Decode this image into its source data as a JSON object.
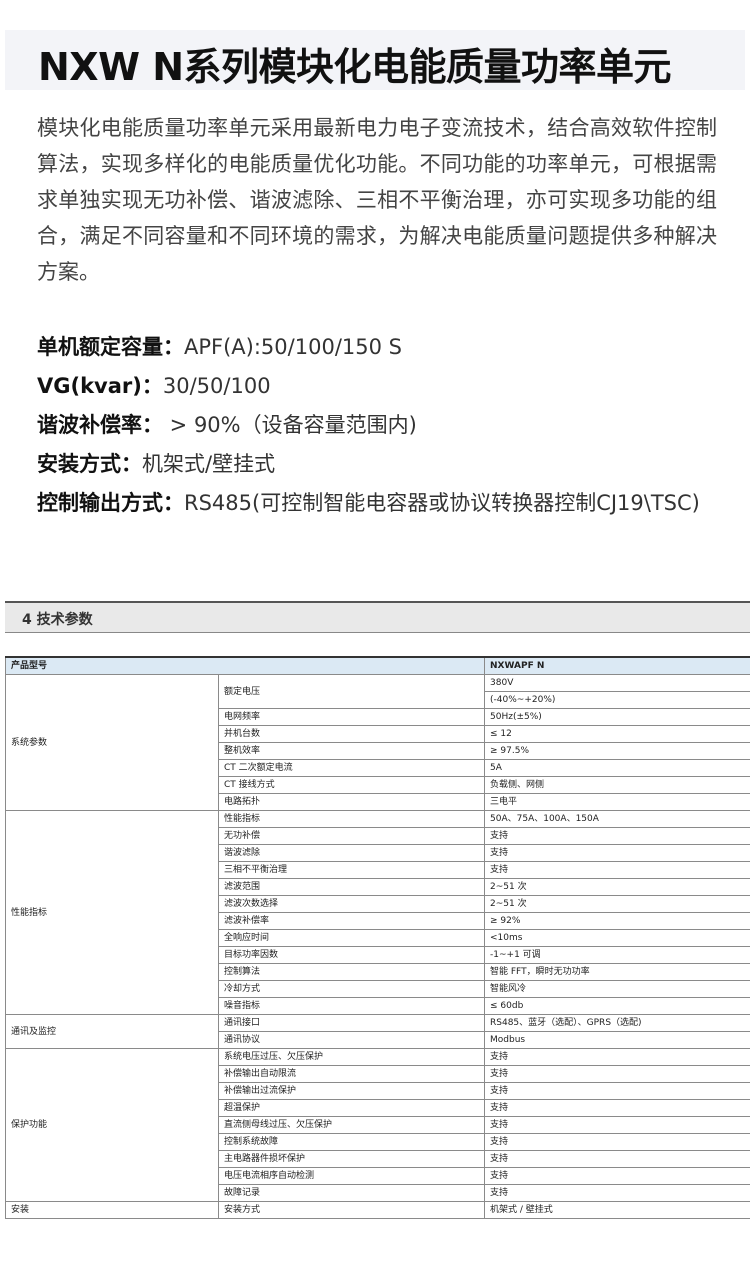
{
  "title": "NXW N系列模块化电能质量功率单元",
  "intro": "模块化电能质量功率单元采用最新电力电子变流技术，结合高效软件控制算法，实现多样化的电能质量优化功能。不同功能的功率单元，可根据需求单独实现无功补偿、谐波滤除、三相不平衡治理，亦可实现多功能的组合，满足不同容量和不同环境的需求，为解决电能质量问题提供多种解决方案。",
  "specs": [
    {
      "label": "单机额定容量：",
      "value": "APF(A):50/100/150 S"
    },
    {
      "label": "VG(kvar)：",
      "value": "30/50/100"
    },
    {
      "label": "谐波补偿率：",
      "value": " > 90%（设备容量范围内)"
    },
    {
      "label": "安装方式：",
      "value": "机架式/壁挂式"
    },
    {
      "label": "控制输出方式：",
      "value": "RS485(可控制智能电容器或协议转换器控制CJ19\\TSC)"
    }
  ],
  "section_title": "4 技术参数",
  "table": {
    "header": {
      "label": "产品型号",
      "model": "NXWAPF N"
    },
    "groups": [
      {
        "category": "系统参数",
        "rows": [
          {
            "item": "额定电压",
            "values": [
              "380V",
              "(-40%~+20%)"
            ]
          },
          {
            "item": "电网频率",
            "values": [
              "50Hz(±5%)"
            ]
          },
          {
            "item": "并机台数",
            "values": [
              "≤ 12"
            ]
          },
          {
            "item": "整机效率",
            "values": [
              "≥ 97.5%"
            ]
          },
          {
            "item": "CT 二次额定电流",
            "values": [
              "5A"
            ]
          },
          {
            "item": "CT 接线方式",
            "values": [
              "负载侧、网侧"
            ]
          },
          {
            "item": "电路拓扑",
            "values": [
              "三电平"
            ]
          }
        ]
      },
      {
        "category": "性能指标",
        "rows": [
          {
            "item": "性能指标",
            "values": [
              "50A、75A、100A、150A"
            ]
          },
          {
            "item": "无功补偿",
            "values": [
              "支持"
            ]
          },
          {
            "item": "谐波滤除",
            "values": [
              "支持"
            ]
          },
          {
            "item": "三相不平衡治理",
            "values": [
              "支持"
            ]
          },
          {
            "item": "滤波范围",
            "values": [
              "2~51 次"
            ]
          },
          {
            "item": "滤波次数选择",
            "values": [
              "2~51 次"
            ]
          },
          {
            "item": "滤波补偿率",
            "values": [
              "≥ 92%"
            ]
          },
          {
            "item": "全响应时间",
            "values": [
              "<10ms"
            ]
          },
          {
            "item": "目标功率因数",
            "values": [
              "-1~+1 可调"
            ]
          },
          {
            "item": "控制算法",
            "values": [
              "智能 FFT，瞬时无功功率"
            ]
          },
          {
            "item": "冷却方式",
            "values": [
              "智能风冷"
            ]
          },
          {
            "item": "噪音指标",
            "values": [
              "≤ 60db"
            ]
          }
        ]
      },
      {
        "category": "通讯及监控",
        "rows": [
          {
            "item": "通讯接口",
            "values": [
              "RS485、蓝牙（选配）、GPRS（选配)"
            ]
          },
          {
            "item": "通讯协议",
            "values": [
              "Modbus"
            ]
          }
        ]
      },
      {
        "category": "保护功能",
        "rows": [
          {
            "item": "系统电压过压、欠压保护",
            "values": [
              "支持"
            ]
          },
          {
            "item": "补偿输出自动限流",
            "values": [
              "支持"
            ]
          },
          {
            "item": "补偿输出过流保护",
            "values": [
              "支持"
            ]
          },
          {
            "item": "超温保护",
            "values": [
              "支持"
            ]
          },
          {
            "item": "直流侧母线过压、欠压保护",
            "values": [
              "支持"
            ]
          },
          {
            "item": "控制系统故障",
            "values": [
              "支持"
            ]
          },
          {
            "item": "主电路器件损坏保护",
            "values": [
              "支持"
            ]
          },
          {
            "item": "电压电流相序自动检测",
            "values": [
              "支持"
            ]
          },
          {
            "item": "故障记录",
            "values": [
              "支持"
            ]
          }
        ]
      },
      {
        "category": "安装",
        "rows": [
          {
            "item": "安装方式",
            "values": [
              "机架式 / 壁挂式"
            ]
          }
        ]
      }
    ]
  }
}
